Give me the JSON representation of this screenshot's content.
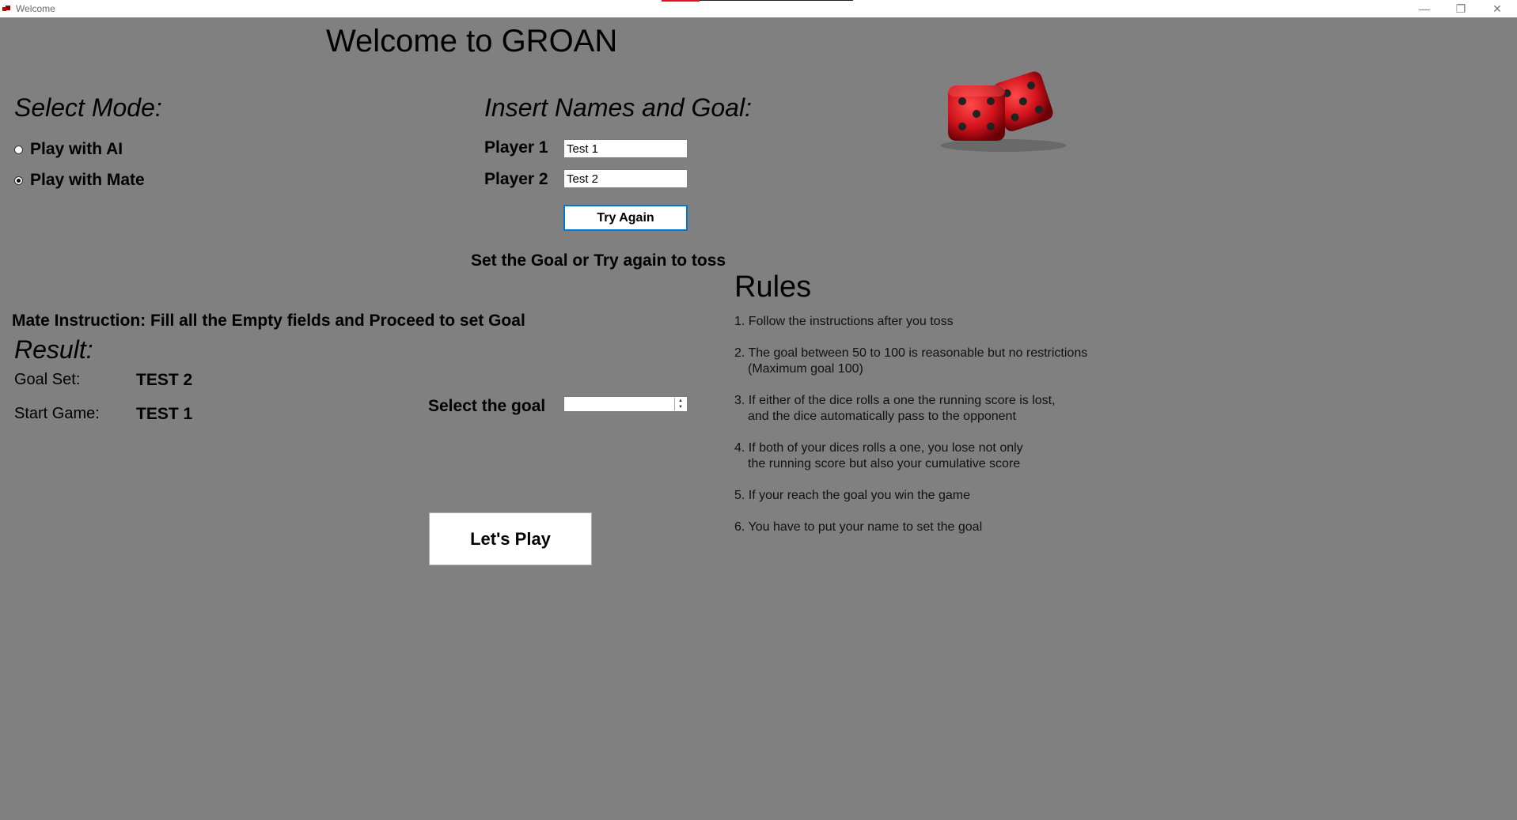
{
  "window": {
    "title": "Welcome",
    "icon": "dice-app-icon"
  },
  "header": {
    "title": "Welcome to GROAN"
  },
  "mode": {
    "heading": "Select Mode:",
    "options": [
      {
        "label": "Play with AI",
        "checked": false
      },
      {
        "label": "Play with Mate",
        "checked": true
      }
    ]
  },
  "players": {
    "heading": "Insert Names and Goal:",
    "player1_label": "Player 1",
    "player1_value": "Test 1",
    "player2_label": "Player 2",
    "player2_value": "Test 2",
    "try_again_label": "Try Again",
    "status": "Set the Goal or Try again to toss"
  },
  "instruction": "Mate Instruction: Fill all the Empty fields and Proceed to set Goal",
  "result": {
    "heading": "Result:",
    "goal_set_label": "Goal Set:",
    "goal_set_value": "TEST 2",
    "start_game_label": "Start Game:",
    "start_game_value": "TEST 1"
  },
  "goal": {
    "label": "Select the goal",
    "value": ""
  },
  "play_button": "Let's Play",
  "rules": {
    "heading": "Rules",
    "items": [
      {
        "num": "1.",
        "line1": "Follow the instructions after you toss",
        "line2": ""
      },
      {
        "num": "2.",
        "line1": "The goal between 50 to 100 is reasonable but no restrictions",
        "line2": "(Maximum goal 100)"
      },
      {
        "num": "3.",
        "line1": "If either of the dice rolls a one the running score is lost,",
        "line2": "and the dice automatically pass to the opponent"
      },
      {
        "num": "4.",
        "line1": "If both of your dices rolls a one, you lose not only",
        "line2": "the running score but also your cumulative score"
      },
      {
        "num": "5.",
        "line1": "If your reach the goal you win the game",
        "line2": ""
      },
      {
        "num": "6.",
        "line1": "You have to put your name to set the goal",
        "line2": ""
      }
    ]
  },
  "colors": {
    "background": "#808080",
    "accent": "#0078d7",
    "dice": "#d0121b"
  }
}
